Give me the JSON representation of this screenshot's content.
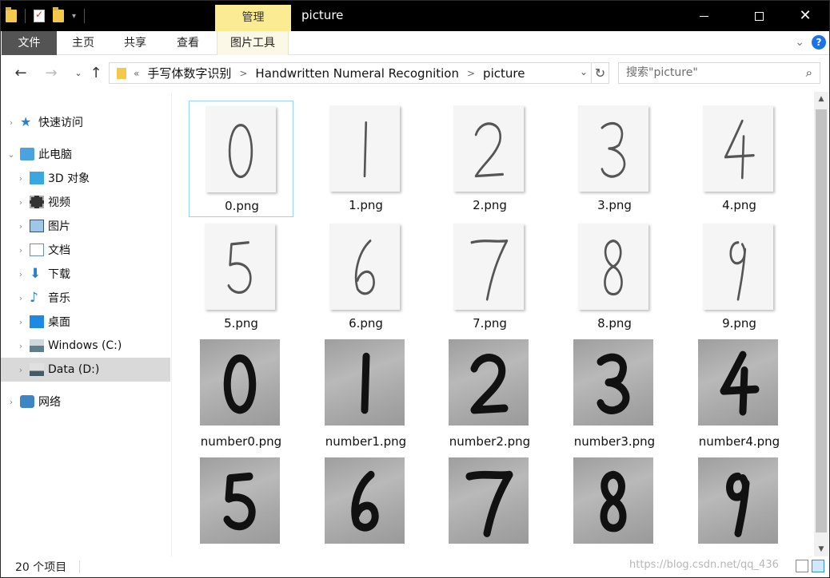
{
  "window": {
    "title": "picture",
    "context_tab": "管理"
  },
  "ribbon": {
    "tabs": [
      "文件",
      "主页",
      "共享",
      "查看",
      "图片工具"
    ]
  },
  "address": {
    "crumbs": [
      "手写体数字识别",
      "Handwritten Numeral Recognition",
      "picture"
    ],
    "overflow": "«"
  },
  "search": {
    "placeholder": "搜索\"picture\""
  },
  "navpane": {
    "quick_access": "快速访问",
    "this_pc": "此电脑",
    "items": [
      {
        "label": "3D 对象",
        "icon": "3d-objects-icon"
      },
      {
        "label": "视频",
        "icon": "video-icon"
      },
      {
        "label": "图片",
        "icon": "pictures-icon"
      },
      {
        "label": "文档",
        "icon": "documents-icon"
      },
      {
        "label": "下载",
        "icon": "downloads-icon"
      },
      {
        "label": "音乐",
        "icon": "music-icon"
      },
      {
        "label": "桌面",
        "icon": "desktop-icon"
      },
      {
        "label": "Windows (C:)",
        "icon": "drive-c-icon"
      },
      {
        "label": "Data (D:)",
        "icon": "drive-d-icon"
      }
    ],
    "network": "网络"
  },
  "files": [
    {
      "name": "0.png",
      "digit": "0",
      "kind": "clean"
    },
    {
      "name": "1.png",
      "digit": "1",
      "kind": "clean"
    },
    {
      "name": "2.png",
      "digit": "2",
      "kind": "clean"
    },
    {
      "name": "3.png",
      "digit": "3",
      "kind": "clean"
    },
    {
      "name": "4.png",
      "digit": "4",
      "kind": "clean"
    },
    {
      "name": "5.png",
      "digit": "5",
      "kind": "clean"
    },
    {
      "name": "6.png",
      "digit": "6",
      "kind": "clean"
    },
    {
      "name": "7.png",
      "digit": "7",
      "kind": "clean"
    },
    {
      "name": "8.png",
      "digit": "8",
      "kind": "clean"
    },
    {
      "name": "9.png",
      "digit": "9",
      "kind": "clean"
    },
    {
      "name": "number0.png",
      "digit": "0",
      "kind": "photo"
    },
    {
      "name": "number1.png",
      "digit": "1",
      "kind": "photo"
    },
    {
      "name": "number2.png",
      "digit": "2",
      "kind": "photo"
    },
    {
      "name": "number3.png",
      "digit": "3",
      "kind": "photo"
    },
    {
      "name": "number4.png",
      "digit": "4",
      "kind": "photo"
    },
    {
      "name": "",
      "digit": "5",
      "kind": "photo"
    },
    {
      "name": "",
      "digit": "6",
      "kind": "photo"
    },
    {
      "name": "",
      "digit": "7",
      "kind": "photo"
    },
    {
      "name": "",
      "digit": "8",
      "kind": "photo"
    },
    {
      "name": "",
      "digit": "9",
      "kind": "photo"
    }
  ],
  "status": {
    "count": "20 个项目",
    "watermark": "https://blog.csdn.net/qq_436"
  }
}
